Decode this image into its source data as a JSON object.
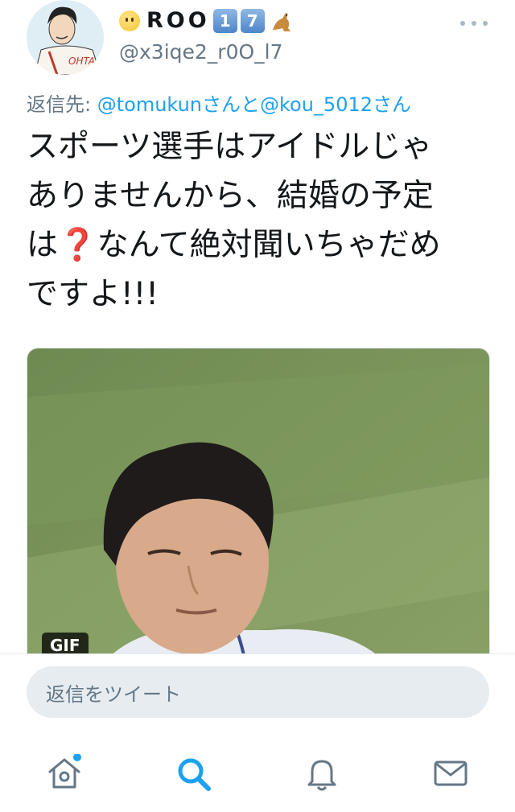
{
  "tweet": {
    "author": {
      "display_name": "ROO",
      "display_name_suffix": [
        "1",
        "7"
      ],
      "handle": "@x3iqe2_r0O_l7"
    },
    "reply_prefix": "返信先: ",
    "reply_mention_1": "@tomukunさん",
    "reply_joiner": "と",
    "reply_mention_2": "@kou_5012さん",
    "text_line_1": "スポーツ選手はアイドルじゃ",
    "text_line_2": "ありませんから、結婚の予定",
    "text_line_3a": "は",
    "text_line_3b": "❓",
    "text_line_3c": "なんて絶対聞いちゃだめ",
    "text_line_4": "ですよ!!!",
    "media_badge": "GIF"
  },
  "composer": {
    "placeholder": "返信をツイート"
  },
  "tab_bar": {
    "items": [
      "home-icon",
      "search-icon",
      "notifications-icon",
      "messages-icon"
    ],
    "active": "search-icon",
    "home_has_badge": true
  },
  "colors": {
    "accent": "#1da1f2",
    "secondary_text": "#657786",
    "question_mark": "#e0245e"
  }
}
